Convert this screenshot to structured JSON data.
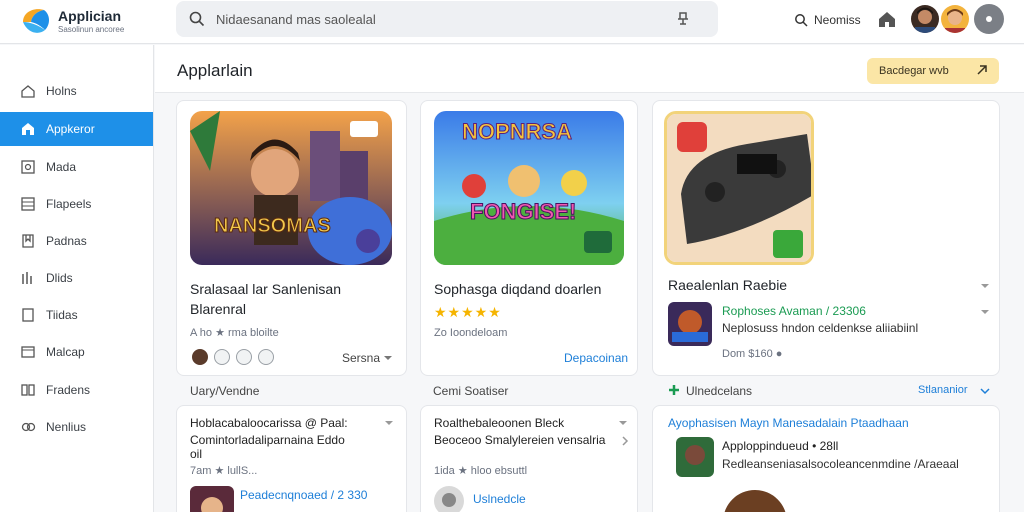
{
  "app": {
    "title": "Applician",
    "subtitle": "Sasolinun ancoree"
  },
  "search": {
    "value": "Nidaesanand mas saolealal"
  },
  "topbar": {
    "search_label": "Neomiss"
  },
  "sidebar": {
    "items": [
      {
        "label": "Holns",
        "icon": "home-icon"
      },
      {
        "label": "Appkeror",
        "icon": "apps-icon",
        "active": true
      },
      {
        "label": "Mada",
        "icon": "media-icon"
      },
      {
        "label": "Flapeels",
        "icon": "grid-icon"
      },
      {
        "label": "Padnas",
        "icon": "tag-icon"
      },
      {
        "label": "Dlids",
        "icon": "chart-icon"
      },
      {
        "label": "Tiidas",
        "icon": "doc-icon"
      },
      {
        "label": "Malcap",
        "icon": "folder-icon"
      },
      {
        "label": "Fradens",
        "icon": "book-icon"
      },
      {
        "label": "Nenlius",
        "icon": "settings-icon"
      }
    ]
  },
  "main": {
    "title": "Applarlain",
    "pill_label": "Bacdegar    wvb"
  },
  "cards": [
    {
      "art_caption": "NANSOMAS",
      "title_line1": "Sralasaal lar Sanlenisan",
      "title_line2": "Blarenral",
      "meta": "A ho ★ rma bloilte",
      "action": "Sersna"
    },
    {
      "art_caption": "NOPNRSA",
      "art_caption2": "FONGISE!",
      "title": "Sophasga diqdand doarlen",
      "meta": "Zo Ioondeloam",
      "action": "Depacoinan"
    },
    {
      "title": "Raealenlan Raebie",
      "item_title": "Rophoses Avaman / 23306",
      "item_desc": "Neplosuss hndon celdenkse aliiabiinl",
      "item_meta": "Dom $160 ●"
    }
  ],
  "sections": [
    {
      "label": "Uary/Vendne"
    },
    {
      "label": "Cemi Soatiser"
    },
    {
      "label": "Ulnedcelans",
      "action": "Stlananior"
    }
  ],
  "bottom_cards": [
    {
      "line1": "Hoblacabaloocarissa  @ Paal:",
      "line2": "Comintorladaliparnaina Eddo",
      "line3": "oil",
      "meta": "7am ★ lullS...",
      "item_title": "Peadecnqnoaed / 2 330"
    },
    {
      "line1": "Roalthebaleoonen Bleck",
      "line2": "Beoceoo Smalylereien vensalria",
      "meta": "1ida ★ hloo ebsuttl",
      "item_title": "Uslnedcle"
    },
    {
      "header": "Ayophasisen Mayn Manesadalain Ptaadhaan",
      "item_title": "Apploppindueud • 28ll",
      "item_desc": "Redleanseniasalsocoleancenmdine /Araeaal"
    }
  ],
  "colors": {
    "accent": "#1e90e8",
    "star": "#f5b400",
    "pill": "#fbe6a6",
    "green": "#1a9b52"
  }
}
